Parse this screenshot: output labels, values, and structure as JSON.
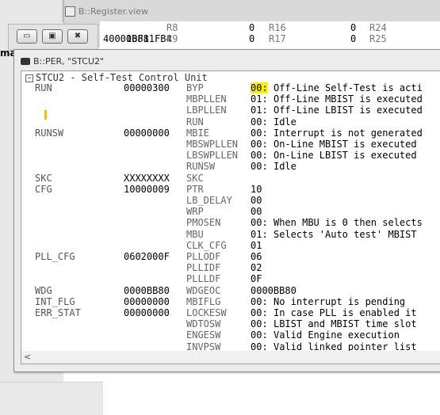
{
  "register_window": {
    "title": "B::Register.view",
    "rows": [
      {
        "val": "00811FB4",
        "reg1": "R8",
        "v1": "0",
        "reg2": "R16",
        "v2": "0",
        "reg3": "R24"
      },
      {
        "val": "40001BF8",
        "reg1": "R9",
        "v1": "0",
        "reg2": "R17",
        "v2": "0",
        "reg3": "R25"
      }
    ]
  },
  "background": {
    "left_text": "ma"
  },
  "button_window": {
    "minimize": "▭",
    "restore": "▣",
    "close": "✖"
  },
  "per_window": {
    "title": "B::PER, \"STCU2\"",
    "header": "STCU2 - Self-Test Control Unit",
    "scroll_left": "<",
    "rows": [
      {
        "name": "RUN",
        "value": "00000300",
        "field": "BYP",
        "fval": "00:",
        "desc": " Off-Line Self-Test is acti"
      },
      {
        "name": "",
        "value": "",
        "field": "MBPLLEN",
        "fval": "01:",
        "desc": " Off-Line MBIST is executed"
      },
      {
        "name": "",
        "value": "",
        "field": "LBPLLEN",
        "fval": "01:",
        "desc": " Off-Line LBIST is executed"
      },
      {
        "name": "",
        "value": "",
        "field": "RUN",
        "fval": "00:",
        "desc": " Idle"
      },
      {
        "name": "RUNSW",
        "value": "00000000",
        "field": "MBIE",
        "fval": "00:",
        "desc": " Interrupt is not generated"
      },
      {
        "name": "",
        "value": "",
        "field": "MBSWPLLEN",
        "fval": "00:",
        "desc": " On-Line MBIST is executed"
      },
      {
        "name": "",
        "value": "",
        "field": "LBSWPLLEN",
        "fval": "00:",
        "desc": " On-Line LBIST is executed"
      },
      {
        "name": "",
        "value": "",
        "field": "RUNSW",
        "fval": "00:",
        "desc": " Idle"
      },
      {
        "name": "SKC",
        "value": "XXXXXXXX",
        "field": "SKC",
        "fval": "",
        "desc": ""
      },
      {
        "name": "CFG",
        "value": "10000009",
        "field": "PTR",
        "fval": "10",
        "desc": ""
      },
      {
        "name": "",
        "value": "",
        "field": "LB_DELAY",
        "fval": "00",
        "desc": ""
      },
      {
        "name": "",
        "value": "",
        "field": "WRP",
        "fval": "00",
        "desc": ""
      },
      {
        "name": "",
        "value": "",
        "field": "PMOSEN",
        "fval": "00:",
        "desc": " When MBU is 0 then selects"
      },
      {
        "name": "",
        "value": "",
        "field": "MBU",
        "fval": "01:",
        "desc": " Selects 'Auto test' MBIST"
      },
      {
        "name": "",
        "value": "",
        "field": "CLK_CFG",
        "fval": "01",
        "desc": ""
      },
      {
        "name": "PLL_CFG",
        "value": "0602000F",
        "field": "PLLODF",
        "fval": "06",
        "desc": ""
      },
      {
        "name": "",
        "value": "",
        "field": "PLLIDF",
        "fval": "02",
        "desc": ""
      },
      {
        "name": "",
        "value": "",
        "field": "PLLLDF",
        "fval": "0F",
        "desc": ""
      },
      {
        "name": "WDG",
        "value": "0000BB80",
        "field": "WDGEOC",
        "fval": "0000BB80",
        "desc": ""
      },
      {
        "name": "INT_FLG",
        "value": "00000000",
        "field": "MBIFLG",
        "fval": "00:",
        "desc": " No interrupt is pending"
      },
      {
        "name": "ERR_STAT",
        "value": "00000000",
        "field": "LOCKESW",
        "fval": "00:",
        "desc": " In case PLL is enabled it"
      },
      {
        "name": "",
        "value": "",
        "field": "WDTOSW",
        "fval": "00:",
        "desc": " LBIST and MBIST time slot"
      },
      {
        "name": "",
        "value": "",
        "field": "ENGESW",
        "fval": "00:",
        "desc": " Valid Engine execution"
      },
      {
        "name": "",
        "value": "",
        "field": "INVPSW",
        "fval": "00:",
        "desc": " Valid linked pointer list"
      }
    ]
  },
  "colors": {
    "highlight": "#ffee00",
    "window_bg": "#ececec"
  }
}
